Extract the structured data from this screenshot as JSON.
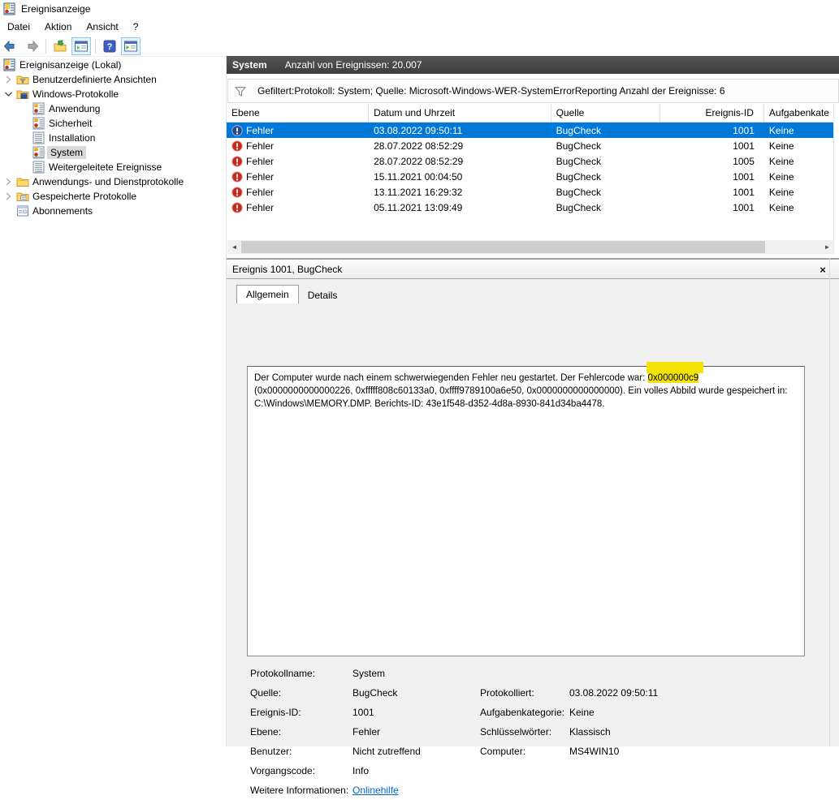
{
  "window": {
    "title": "Ereignisanzeige"
  },
  "menu": {
    "items": [
      "Datei",
      "Aktion",
      "Ansicht",
      "?"
    ]
  },
  "toolbar": {
    "buttons": [
      "back",
      "forward",
      "show-console-tree",
      "console-window",
      "help",
      "action-pane"
    ]
  },
  "icons": {
    "close": "×",
    "scroll_left": "◄",
    "scroll_right": "►"
  },
  "colors": {
    "selection": "#0078d7",
    "highlight": "#f2e206",
    "error_red": "#c42b1c",
    "link_blue": "#0066cc"
  },
  "sidebar": {
    "items": [
      {
        "label": "Ereignisanzeige (Lokal)"
      },
      {
        "label": "Benutzerdefinierte Ansichten"
      },
      {
        "label": "Windows-Protokolle"
      },
      {
        "label": "Anwendung"
      },
      {
        "label": "Sicherheit"
      },
      {
        "label": "Installation"
      },
      {
        "label": "System",
        "selected": true
      },
      {
        "label": "Weitergeleitete Ereignisse"
      },
      {
        "label": "Anwendungs- und Dienstprotokolle"
      },
      {
        "label": "Gespeicherte Protokolle"
      },
      {
        "label": "Abonnements"
      }
    ]
  },
  "main": {
    "header": {
      "title": "System",
      "count": "Anzahl von Ereignissen: 20.007"
    },
    "filter": {
      "text": "Gefiltert:Protokoll: System; Quelle: Microsoft-Windows-WER-SystemErrorReporting Anzahl der Ereignisse: 6"
    },
    "table": {
      "columns": [
        "Ebene",
        "Datum und Uhrzeit",
        "Quelle",
        "Ereignis-ID",
        "Aufgabenkate"
      ],
      "rows": [
        {
          "level": "Fehler",
          "datetime": "03.08.2022 09:50:11",
          "source": "BugCheck",
          "event_id": "1001",
          "category": "Keine"
        },
        {
          "level": "Fehler",
          "datetime": "28.07.2022 08:52:29",
          "source": "BugCheck",
          "event_id": "1001",
          "category": "Keine"
        },
        {
          "level": "Fehler",
          "datetime": "28.07.2022 08:52:29",
          "source": "BugCheck",
          "event_id": "1005",
          "category": "Keine"
        },
        {
          "level": "Fehler",
          "datetime": "15.11.2021 00:04:50",
          "source": "BugCheck",
          "event_id": "1001",
          "category": "Keine"
        },
        {
          "level": "Fehler",
          "datetime": "13.11.2021 16:29:32",
          "source": "BugCheck",
          "event_id": "1001",
          "category": "Keine"
        },
        {
          "level": "Fehler",
          "datetime": "05.11.2021 13:09:49",
          "source": "BugCheck",
          "event_id": "1001",
          "category": "Keine"
        }
      ]
    }
  },
  "details": {
    "title": "Ereignis 1001, BugCheck",
    "tabs": [
      "Allgemein",
      "Details"
    ],
    "description": {
      "before": "Der Computer wurde nach einem schwerwiegenden Fehler neu gestartet. Der Fehlercode war: ",
      "highlight": "0x000000c9",
      "after": " (0x0000000000000226, 0xfffff808c60133a0, 0xffff9789100a6e50, 0x0000000000000000). Ein volles Abbild wurde gespeichert in: C:\\Windows\\MEMORY.DMP. Berichts-ID: 43e1f548-d352-4d8a-8930-841d34ba4478."
    },
    "fields_left": [
      {
        "label": "Protokollname:",
        "value": "System"
      },
      {
        "label": "Quelle:",
        "value": "BugCheck"
      },
      {
        "label": "Ereignis-ID:",
        "value": "1001"
      },
      {
        "label": "Ebene:",
        "value": "Fehler"
      },
      {
        "label": "Benutzer:",
        "value": "Nicht zutreffend"
      },
      {
        "label": "Vorgangscode:",
        "value": "Info"
      },
      {
        "label": "Weitere Informationen:",
        "value": "Onlinehilfe"
      }
    ],
    "fields_right": [
      {
        "label": "Protokolliert:",
        "value": "03.08.2022 09:50:11"
      },
      {
        "label": "Aufgabenkategorie:",
        "value": "Keine"
      },
      {
        "label": "Schlüsselwörter:",
        "value": "Klassisch"
      },
      {
        "label": "Computer:",
        "value": "MS4WIN10"
      }
    ]
  }
}
